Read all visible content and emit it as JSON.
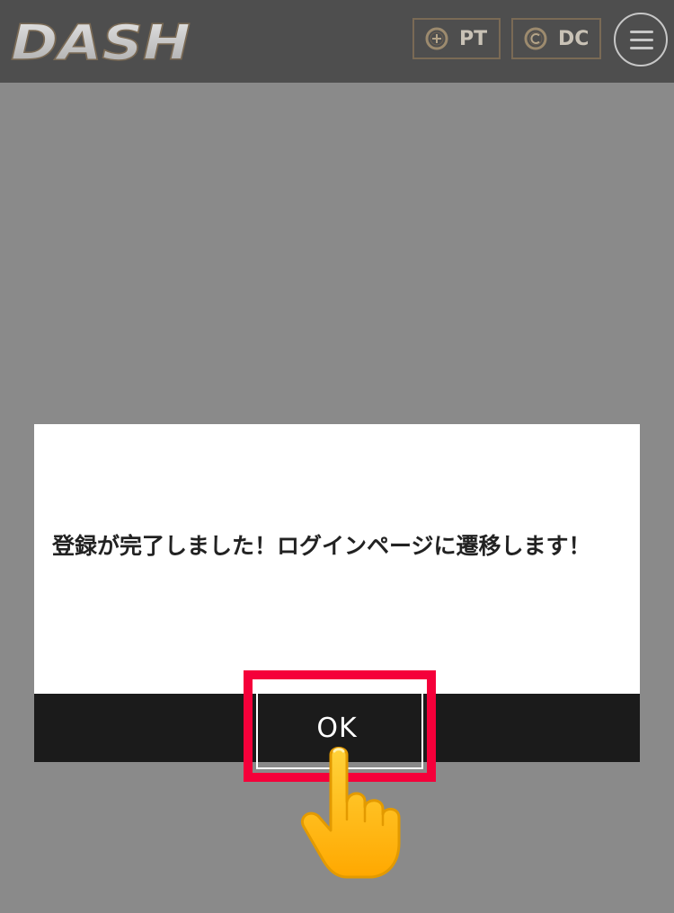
{
  "header": {
    "logo_text": "DASH",
    "currencies": [
      {
        "label": "PT",
        "icon": "plus-coin-icon"
      },
      {
        "label": "DC",
        "icon": "c-coin-icon"
      }
    ],
    "menu_icon": "hamburger-menu-icon"
  },
  "dialog": {
    "message": "登録が完了しました！ログインページに遷移します！",
    "ok_label": "OK"
  },
  "overlay": {
    "highlight_color": "#f5003a",
    "pointer_icon": "pointing-hand-icon"
  },
  "colors": {
    "header_bg": "#4e4e4e",
    "backdrop": "#8a8a8a",
    "dialog_bg": "#ffffff",
    "ok_bar_bg": "#1b1b1b",
    "accent_gold": "#7a6a55"
  }
}
